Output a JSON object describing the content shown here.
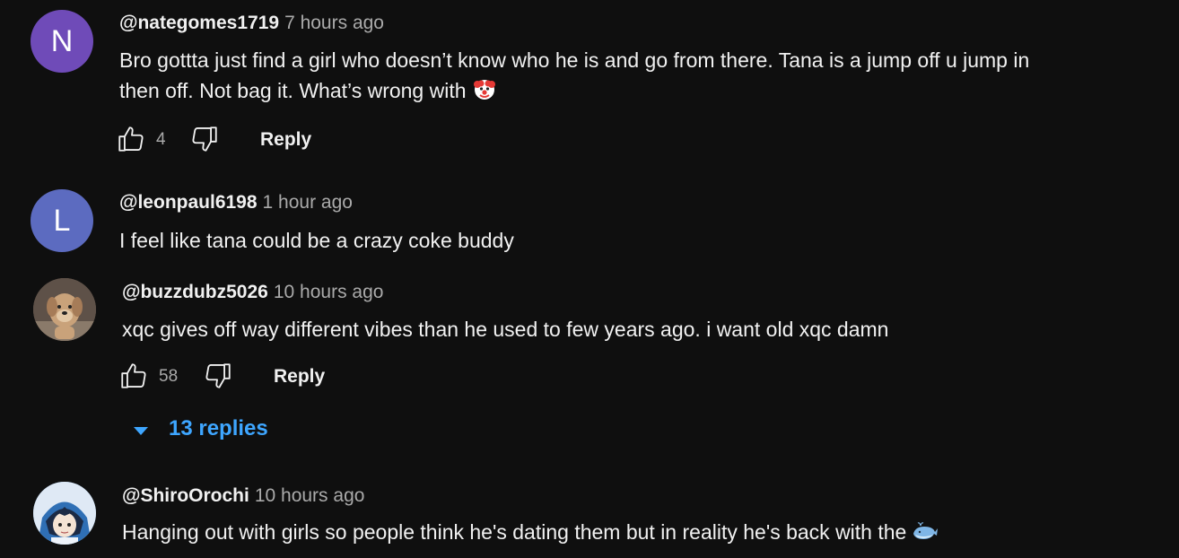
{
  "comments": [
    {
      "avatar_letter": "N",
      "avatar_color": "#6f4bb8",
      "handle": "@nategomes1719",
      "time": "7 hours ago",
      "text_line1": "Bro gottta just find a girl who doesn’t know who he is and go from there. Tana is a jump off u jump in",
      "text_line2": "then off. Not bag it. What’s wrong with",
      "emoji_icon": "clown-face-icon",
      "likes": "4",
      "reply_label": "Reply"
    },
    {
      "avatar_letter": "L",
      "avatar_color": "#5c6bc0",
      "handle": "@leonpaul6198",
      "time": "1 hour ago",
      "text": "I feel like tana could be a crazy coke buddy"
    },
    {
      "avatar_icon": "dog-photo-avatar",
      "handle": "@buzzdubz5026",
      "time": "10 hours ago",
      "text": "xqc gives off way different vibes than he used to few years ago. i want old xqc damn",
      "likes": "58",
      "reply_label": "Reply",
      "replies_label": "13 replies"
    },
    {
      "avatar_icon": "anime-character-avatar",
      "handle": "@ShiroOrochi",
      "time": "10 hours ago",
      "text": "Hanging out with girls so people think he's dating them but in reality he's back with the",
      "emoji_icon": "whale-icon"
    }
  ],
  "colors": {
    "background": "#0f0f0f",
    "text": "#f1f1f1",
    "muted": "#aaaaaa",
    "link": "#3ea6ff"
  }
}
